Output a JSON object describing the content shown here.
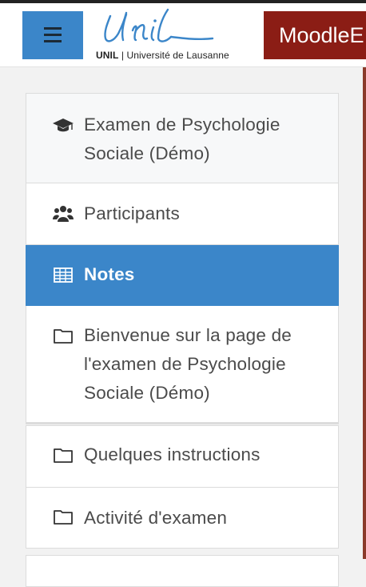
{
  "header": {
    "menu_button_label": "Menu",
    "logo": {
      "wordmark": "Unil",
      "caption_bold": "UNIL",
      "caption_rest": "| Université de Lausanne"
    },
    "brand_text": "MoodleE"
  },
  "nav": {
    "course": "Examen de Psychologie Sociale (Démo)",
    "participants": "Participants",
    "notes": "Notes",
    "welcome": "Bienvenue sur la page de l'examen de Psychologie Sociale (Démo)",
    "instructions": "Quelques instructions",
    "activity": "Activité d'examen"
  },
  "colors": {
    "accent": "#3b86c9",
    "brand": "#8b1d15",
    "text": "#4b4b4b"
  },
  "icons": [
    "bars-icon",
    "graduation-cap-icon",
    "users-icon",
    "table-icon",
    "folder-icon"
  ]
}
